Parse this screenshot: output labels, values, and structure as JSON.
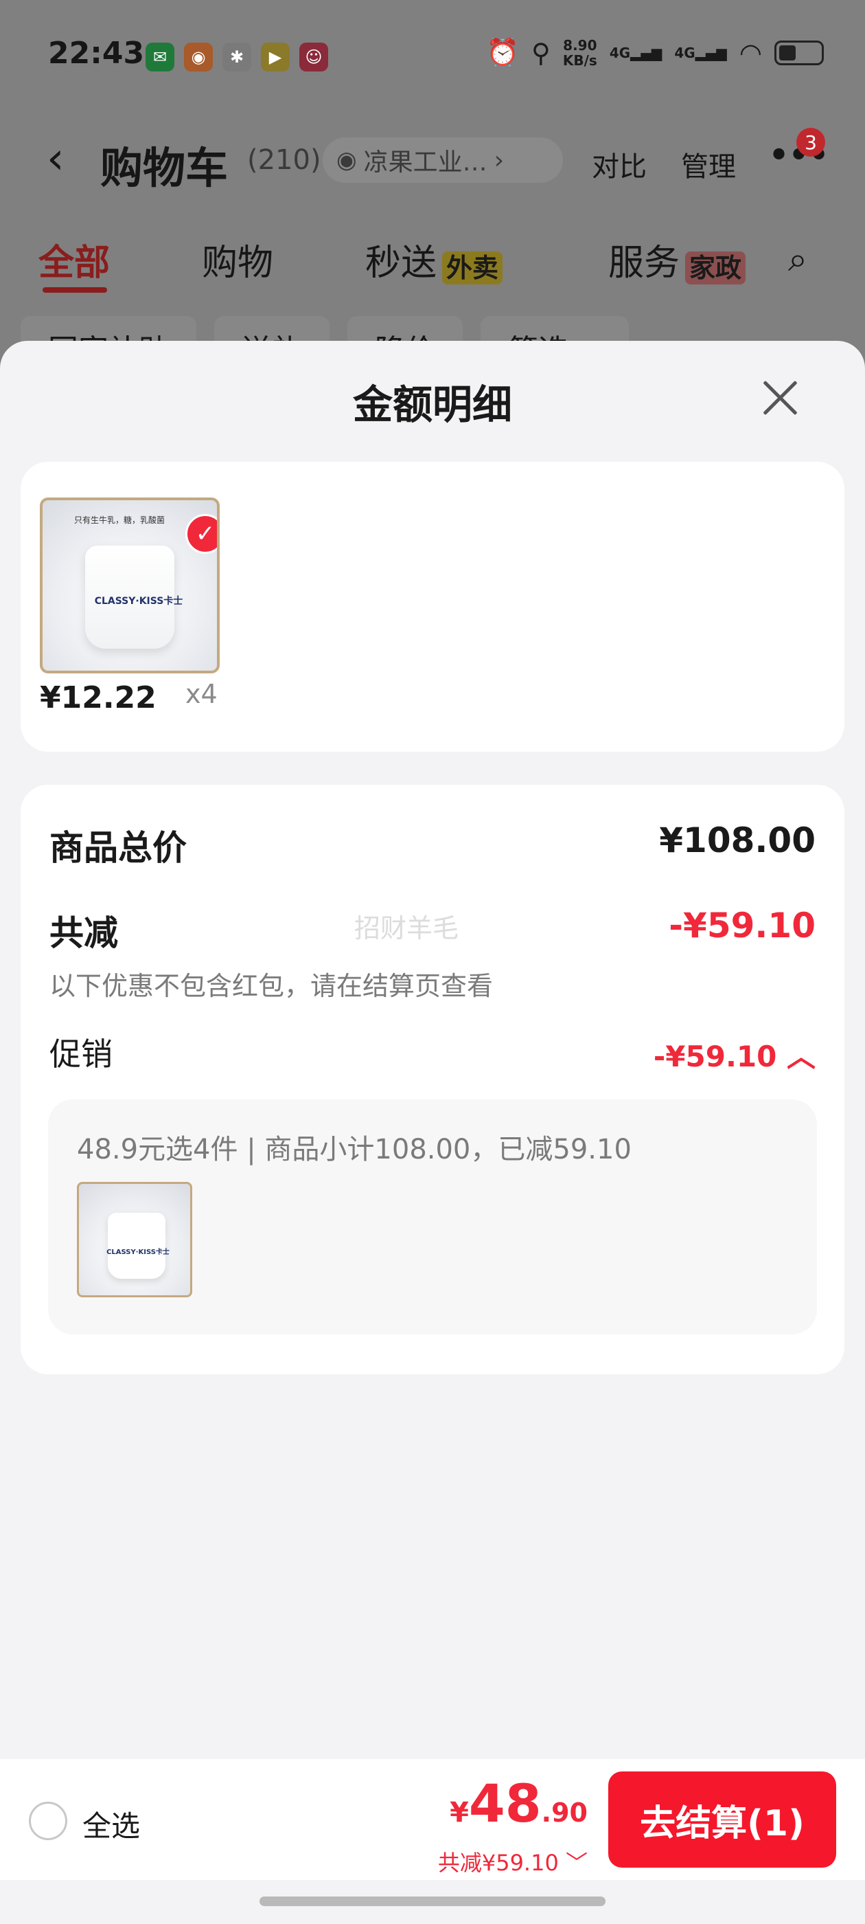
{
  "status_bar": {
    "time": "22:43",
    "net_speed_value": "8.90",
    "net_speed_unit": "KB/s",
    "signal_1": "4G",
    "signal_2": "4G"
  },
  "nav": {
    "title": "购物车",
    "count": "(210)",
    "address": "凉果工业…",
    "compare": "对比",
    "manage": "管理",
    "badge": "3"
  },
  "tabs": [
    {
      "label": "全部"
    },
    {
      "label": "购物"
    },
    {
      "label": "秒送",
      "tag": "外卖"
    },
    {
      "label": "服务",
      "tag": "家政"
    }
  ],
  "filters": [
    "国家补贴",
    "送礼",
    "降价",
    "筛选 ▽"
  ],
  "sheet": {
    "title": "金额明细",
    "items": [
      {
        "price": "¥12.22",
        "qty": "x4",
        "thumb_caption": "只有生牛乳，糖，乳酸菌",
        "thumb_brand": "CLASSY·KISS卡士"
      }
    ],
    "total_label": "商品总价",
    "total_value": "¥108.00",
    "reduce_label": "共减",
    "reduce_value": "-¥59.10",
    "reduce_note": "以下优惠不包含红包，请在结算页查看",
    "watermark": "招财羊毛",
    "promo_label": "促销",
    "promo_value": "-¥59.10 ︿",
    "promo_text": "48.9元选4件 | 商品小计108.00，已减59.10"
  },
  "bottom_bar": {
    "select_all": "全选",
    "pay_yen": "¥",
    "pay_int": "48",
    "pay_dec": ".90",
    "pay_reduce": "共减¥59.10 ﹀",
    "checkout": "去结算(1)"
  },
  "colors": {
    "accent_red": "#f0283a",
    "checkout_red": "#f5172b"
  }
}
